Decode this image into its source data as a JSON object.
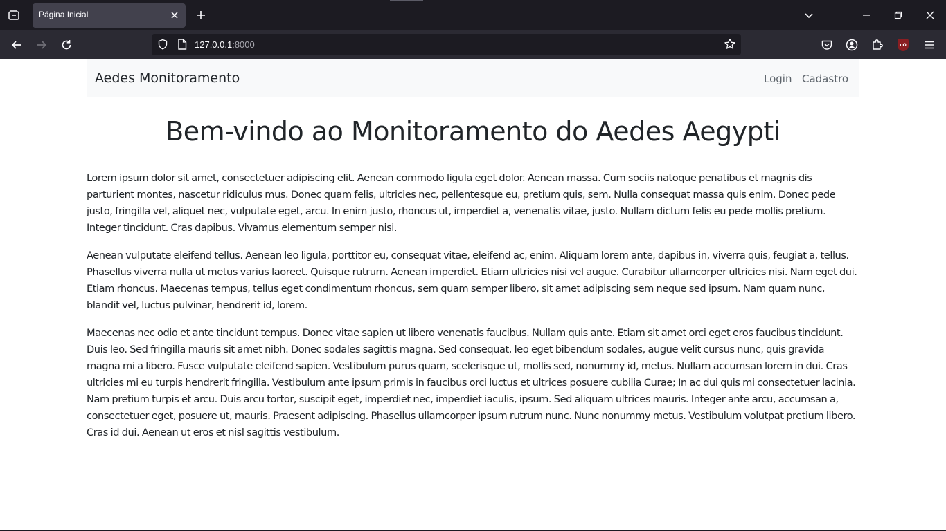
{
  "browser": {
    "tab_title": "Página Inicial",
    "url_host": "127.0.0.1",
    "url_port": ":8000",
    "ublock_label": "uO"
  },
  "site": {
    "brand": "Aedes Monitoramento",
    "nav": {
      "login": "Login",
      "cadastro": "Cadastro"
    },
    "headline": "Bem-vindo ao Monitoramento do Aedes Aegypti",
    "paragraphs": [
      "Lorem ipsum dolor sit amet, consectetuer adipiscing elit. Aenean commodo ligula eget dolor. Aenean massa. Cum sociis natoque penatibus et magnis dis parturient montes, nascetur ridiculus mus. Donec quam felis, ultricies nec, pellentesque eu, pretium quis, sem. Nulla consequat massa quis enim. Donec pede justo, fringilla vel, aliquet nec, vulputate eget, arcu. In enim justo, rhoncus ut, imperdiet a, venenatis vitae, justo. Nullam dictum felis eu pede mollis pretium. Integer tincidunt. Cras dapibus. Vivamus elementum semper nisi.",
      "Aenean vulputate eleifend tellus. Aenean leo ligula, porttitor eu, consequat vitae, eleifend ac, enim. Aliquam lorem ante, dapibus in, viverra quis, feugiat a, tellus. Phasellus viverra nulla ut metus varius laoreet. Quisque rutrum. Aenean imperdiet. Etiam ultricies nisi vel augue. Curabitur ullamcorper ultricies nisi. Nam eget dui. Etiam rhoncus. Maecenas tempus, tellus eget condimentum rhoncus, sem quam semper libero, sit amet adipiscing sem neque sed ipsum. Nam quam nunc, blandit vel, luctus pulvinar, hendrerit id, lorem.",
      "Maecenas nec odio et ante tincidunt tempus. Donec vitae sapien ut libero venenatis faucibus. Nullam quis ante. Etiam sit amet orci eget eros faucibus tincidunt. Duis leo. Sed fringilla mauris sit amet nibh. Donec sodales sagittis magna. Sed consequat, leo eget bibendum sodales, augue velit cursus nunc, quis gravida magna mi a libero. Fusce vulputate eleifend sapien. Vestibulum purus quam, scelerisque ut, mollis sed, nonummy id, metus. Nullam accumsan lorem in dui. Cras ultricies mi eu turpis hendrerit fringilla. Vestibulum ante ipsum primis in faucibus orci luctus et ultrices posuere cubilia Curae; In ac dui quis mi consectetuer lacinia. Nam pretium turpis et arcu. Duis arcu tortor, suscipit eget, imperdiet nec, imperdiet iaculis, ipsum. Sed aliquam ultrices mauris. Integer ante arcu, accumsan a, consectetuer eget, posuere ut, mauris. Praesent adipiscing. Phasellus ullamcorper ipsum rutrum nunc. Nunc nonummy metus. Vestibulum volutpat pretium libero. Cras id dui. Aenean ut eros et nisl sagittis vestibulum."
    ]
  },
  "colors": {
    "chrome_dark": "#1c1b22",
    "toolbar": "#2b2a33",
    "active_tab": "#42414d",
    "navbar_bg": "#f8f9fa",
    "text": "#212529",
    "nav_link": "#5c636a"
  },
  "icons": {
    "tab_list": "tab-list-icon",
    "tab_close": "close-icon",
    "new_tab": "plus-icon",
    "back": "arrow-left-icon",
    "forward": "arrow-right-icon",
    "reload": "reload-icon",
    "tracking": "shield-icon",
    "page": "page-icon",
    "bookmark": "star-icon",
    "pocket": "pocket-icon",
    "account": "account-icon",
    "extensions": "puzzle-icon",
    "ublock": "ublock-icon",
    "menu": "hamburger-menu-icon"
  }
}
